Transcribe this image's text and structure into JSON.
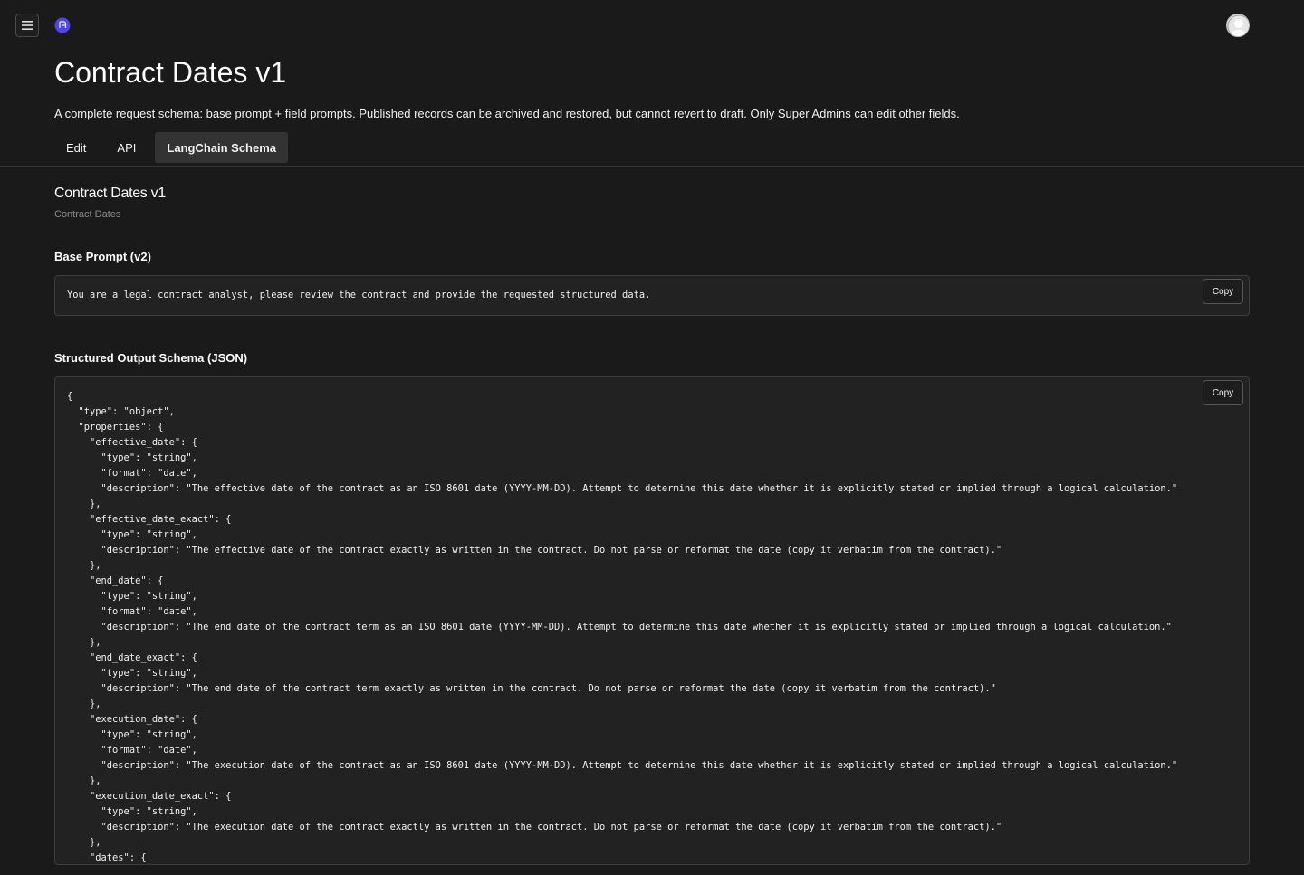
{
  "header": {
    "menu_icon": "hamburger-menu-icon",
    "logo_icon": "app-logo-icon",
    "avatar_icon": "user-avatar-icon",
    "logo_color": "#4f46e5"
  },
  "page": {
    "title": "Contract Dates v1",
    "description": "A complete request schema: base prompt + field prompts. Published records can be archived and restored, but cannot revert to draft. Only Super Admins can edit other fields."
  },
  "tabs": [
    {
      "label": "Edit",
      "active": false
    },
    {
      "label": "API",
      "active": false
    },
    {
      "label": "LangChain Schema",
      "active": true
    }
  ],
  "schema": {
    "title": "Contract Dates v1",
    "subtitle": "Contract Dates"
  },
  "base_prompt": {
    "label": "Base Prompt (v2)",
    "copy_label": "Copy",
    "text": "You are a legal contract analyst, please review the contract and provide the requested structured data."
  },
  "output_schema": {
    "label": "Structured Output Schema (JSON)",
    "copy_label": "Copy",
    "code": "{\n  \"type\": \"object\",\n  \"properties\": {\n    \"effective_date\": {\n      \"type\": \"string\",\n      \"format\": \"date\",\n      \"description\": \"The effective date of the contract as an ISO 8601 date (YYYY-MM-DD). Attempt to determine this date whether it is explicitly stated or implied through a logical calculation.\"\n    },\n    \"effective_date_exact\": {\n      \"type\": \"string\",\n      \"description\": \"The effective date of the contract exactly as written in the contract. Do not parse or reformat the date (copy it verbatim from the contract).\"\n    },\n    \"end_date\": {\n      \"type\": \"string\",\n      \"format\": \"date\",\n      \"description\": \"The end date of the contract term as an ISO 8601 date (YYYY-MM-DD). Attempt to determine this date whether it is explicitly stated or implied through a logical calculation.\"\n    },\n    \"end_date_exact\": {\n      \"type\": \"string\",\n      \"description\": \"The end date of the contract term exactly as written in the contract. Do not parse or reformat the date (copy it verbatim from the contract).\"\n    },\n    \"execution_date\": {\n      \"type\": \"string\",\n      \"format\": \"date\",\n      \"description\": \"The execution date of the contract as an ISO 8601 date (YYYY-MM-DD). Attempt to determine this date whether it is explicitly stated or implied through a logical calculation.\"\n    },\n    \"execution_date_exact\": {\n      \"type\": \"string\",\n      \"description\": \"The execution date of the contract exactly as written in the contract. Do not parse or reformat the date (copy it verbatim from the contract).\"\n    },\n    \"dates\": {"
  }
}
